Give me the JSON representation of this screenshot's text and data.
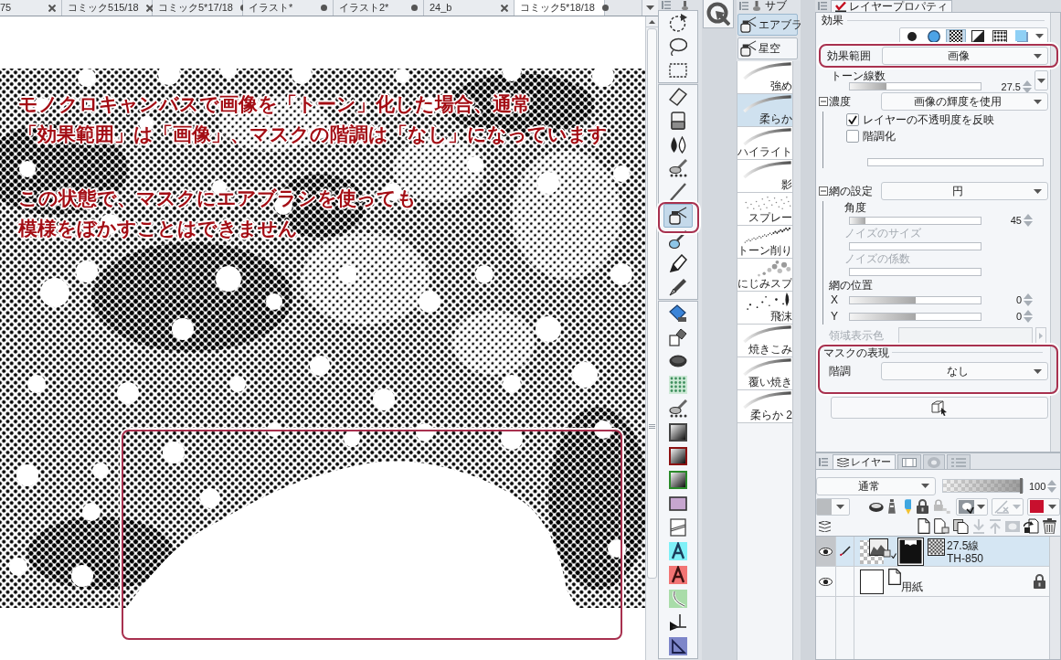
{
  "document_tabs": [
    {
      "title": "75",
      "modified": false,
      "selected": false
    },
    {
      "title": "コミック5",
      "pages": "15/18",
      "modified": false,
      "selected": false
    },
    {
      "title": "コミック5*",
      "pages": "17/18",
      "modified": true,
      "selected": false
    },
    {
      "title": "イラスト*",
      "modified": true,
      "selected": false
    },
    {
      "title": "イラスト2*",
      "modified": true,
      "selected": false
    },
    {
      "title": "24_b",
      "modified": false,
      "selected": false
    },
    {
      "title": "コミック5*",
      "pages": "18/18",
      "modified": true,
      "selected": true
    }
  ],
  "notes": [
    {
      "lines": [
        "モノクロキャンバスで画像を「トーン」化した場合、通常",
        "「効果範囲」は「画像」、マスクの階調は「なし」になっています"
      ]
    },
    {
      "lines": [
        "この状態で、マスクにエアブラシを使っても",
        "模様をぼかすことはできません"
      ]
    }
  ],
  "tool_palette": {
    "groups": [
      {
        "tools": [
          {
            "kind": "rotate-select",
            "selected": false
          },
          {
            "kind": "lasso",
            "selected": false
          },
          {
            "kind": "marquee",
            "selected": false
          }
        ]
      },
      {
        "tools": [
          {
            "kind": "eraser",
            "selected": false
          },
          {
            "kind": "eraser-block",
            "selected": false
          },
          {
            "kind": "blur",
            "selected": false
          },
          {
            "kind": "blend",
            "selected": false
          },
          {
            "kind": "pen-thin",
            "selected": false
          },
          {
            "kind": "airbrush",
            "selected": true
          },
          {
            "kind": "brush",
            "selected": false
          },
          {
            "kind": "ink-brush",
            "selected": false
          },
          {
            "kind": "nib",
            "selected": false
          }
        ]
      },
      {
        "tools": [
          {
            "kind": "fill",
            "selected": false
          },
          {
            "kind": "fill-ref",
            "selected": false
          },
          {
            "kind": "lasso-fill",
            "selected": false
          },
          {
            "kind": "tone",
            "selected": false
          },
          {
            "kind": "blend",
            "selected": false
          },
          {
            "kind": "gradient",
            "selected": false
          },
          {
            "kind": "gradient-red",
            "selected": false
          },
          {
            "kind": "gradient-green",
            "selected": false
          },
          {
            "kind": "shape",
            "selected": false
          },
          {
            "kind": "frame",
            "selected": false
          },
          {
            "kind": "text",
            "selected": false
          },
          {
            "kind": "text-red",
            "selected": false
          },
          {
            "kind": "balloon",
            "selected": false
          },
          {
            "kind": "ruler",
            "selected": false
          },
          {
            "kind": "ruler-tri",
            "selected": false
          }
        ]
      }
    ]
  },
  "subtool_panel": {
    "title": "サブ",
    "tabs": [
      {
        "label": "エアブラ",
        "selected": true
      },
      {
        "label": "星空",
        "selected": false
      }
    ],
    "brushes": [
      {
        "label": "強め",
        "kind": "stroke",
        "selected": false
      },
      {
        "label": "柔らか",
        "kind": "stroke",
        "selected": true
      },
      {
        "label": "ハイライト",
        "kind": "stroke",
        "selected": false
      },
      {
        "label": "影",
        "kind": "stroke",
        "selected": false
      },
      {
        "label": "スプレー",
        "kind": "spray",
        "selected": false
      },
      {
        "label": "トーン削り",
        "kind": "speckle",
        "selected": false
      },
      {
        "label": "にじみスプ",
        "kind": "blot",
        "selected": false
      },
      {
        "label": "飛沫",
        "kind": "splash",
        "selected": false
      },
      {
        "label": "焼きこみ",
        "kind": "stroke",
        "selected": false
      },
      {
        "label": "覆い焼き",
        "kind": "stroke",
        "selected": false
      },
      {
        "label": "柔らか 2",
        "kind": "stroke",
        "selected": false
      }
    ]
  },
  "layer_property": {
    "title": "レイヤープロパティ",
    "effect_heading": "効果",
    "effects": [
      {
        "kind": "dot",
        "selected": false
      },
      {
        "kind": "circle",
        "selected": false
      },
      {
        "kind": "halftone",
        "selected": true
      },
      {
        "kind": "diagonal",
        "selected": false
      },
      {
        "kind": "pattern",
        "selected": false
      },
      {
        "kind": "square",
        "selected": false
      }
    ],
    "rows": [
      {
        "kind": "combo",
        "label": "効果範囲",
        "value": "画像"
      },
      {
        "kind": "slider",
        "label": "トーン線数",
        "level": 0.28,
        "value": "27.5",
        "menu": true,
        "disabled": false
      },
      {
        "kind": "section",
        "label": "濃度",
        "value": "画像の輝度を使用",
        "expanded": true,
        "children": [
          {
            "kind": "checkbox",
            "label": "レイヤーの不透明度を反映",
            "checked": true
          },
          {
            "kind": "checkbox",
            "label": "階調化",
            "checked": false
          },
          {
            "kind": "track"
          }
        ]
      },
      {
        "kind": "section",
        "label": "網の設定",
        "value": "円",
        "expanded": true,
        "children": [
          {
            "kind": "slider",
            "label": "角度",
            "level": 0.12,
            "value": "45",
            "disabled": false
          },
          {
            "kind": "slider",
            "label": "ノイズのサイズ",
            "disabled": true
          },
          {
            "kind": "slider",
            "label": "ノイズの係数",
            "disabled": true
          },
          {
            "kind": "heading",
            "label": "網の位置"
          },
          {
            "kind": "inline-slider",
            "label": "X",
            "level": 0.5,
            "value": "0"
          },
          {
            "kind": "inline-slider",
            "label": "Y",
            "level": 0.5,
            "value": "0"
          }
        ]
      },
      {
        "kind": "color",
        "label": "領域表示色",
        "disabled": true
      },
      {
        "kind": "group",
        "label": "マスクの表現",
        "children": [
          {
            "kind": "inline-dropdown",
            "label": "階調",
            "value": "なし"
          }
        ]
      },
      {
        "kind": "button"
      }
    ]
  },
  "layer_panel": {
    "tabs": [
      {
        "kind": "layers",
        "label": "レイヤー",
        "selected": true
      },
      {
        "kind": "timeline",
        "selected": false
      },
      {
        "kind": "disc",
        "selected": false
      },
      {
        "kind": "list",
        "selected": false
      }
    ],
    "blend_mode": "通常",
    "opacity": {
      "level": 1,
      "value": "100"
    },
    "layers": [
      {
        "kind": "tone",
        "name": "27.5線",
        "detail": "TH-850",
        "visible": true,
        "editing": true,
        "selected": true,
        "mask": true,
        "locked": false
      },
      {
        "kind": "paper",
        "name": "用紙",
        "visible": true,
        "editing": false,
        "selected": false,
        "mask": false,
        "locked": true
      }
    ]
  }
}
